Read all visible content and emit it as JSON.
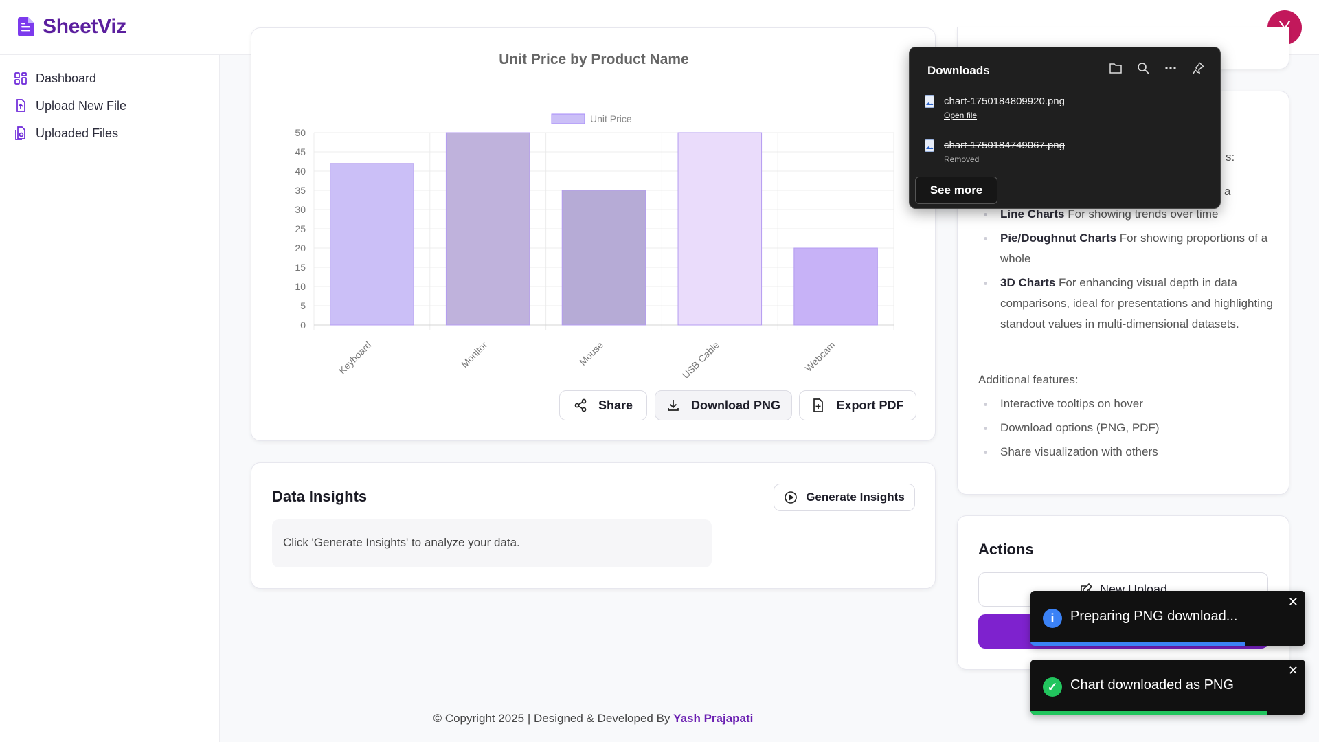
{
  "app": {
    "name": "SheetViz",
    "avatar_letter": "Y",
    "avatar_color": "#c2185b",
    "brand_color": "#5b1f9e"
  },
  "sidebar": {
    "items": [
      {
        "label": "Dashboard",
        "icon": "grid-icon"
      },
      {
        "label": "Upload New File",
        "icon": "file-upload-icon"
      },
      {
        "label": "Uploaded Files",
        "icon": "files-icon"
      }
    ]
  },
  "chart_data": {
    "type": "bar",
    "title": "Unit Price by Product Name",
    "categories": [
      "Keyboard",
      "Monitor",
      "Mouse",
      "USB Cable",
      "Webcam"
    ],
    "series": [
      {
        "name": "Unit Price",
        "values": [
          42,
          50,
          35,
          50,
          20
        ]
      }
    ],
    "bar_colors": [
      "#cbbff7",
      "#bfb2dc",
      "#b6abd6",
      "#eadcfb",
      "#c7b2f7"
    ],
    "ylim": [
      0,
      50
    ],
    "yticks": [
      0,
      5,
      10,
      15,
      20,
      25,
      30,
      35,
      40,
      45,
      50
    ],
    "grid": true,
    "legend": "top"
  },
  "chart_actions": {
    "share": "Share",
    "download": "Download PNG",
    "export": "Export PDF"
  },
  "insights": {
    "title": "Data Insights",
    "generate_label": "Generate Insights",
    "placeholder": "Click 'Generate Insights' to analyze your data."
  },
  "info": {
    "partial_line1": "s:",
    "partial_line2": "a",
    "chart_types": [
      {
        "name": "Line Charts",
        "desc": " For showing trends over time"
      },
      {
        "name": "Pie/Doughnut Charts",
        "desc": " For showing proportions of a whole"
      },
      {
        "name": "3D Charts",
        "desc": " For enhancing visual depth in data comparisons, ideal for presentations and highlighting standout values in multi-dimensional datasets."
      }
    ],
    "additional_label": "Additional features:",
    "features": [
      "Interactive tooltips on hover",
      "Download options (PNG, PDF)",
      "Share visualization with others"
    ]
  },
  "actions": {
    "title": "Actions",
    "new_upload": "New Upload",
    "primary_color": "#7e22ce"
  },
  "footer": {
    "text": "© Copyright 2025 | Designed & Developed By ",
    "author": "Yash Prajapati"
  },
  "downloads": {
    "title": "Downloads",
    "items": [
      {
        "name": "chart-1750184809920.png",
        "sub": "Open file"
      },
      {
        "name": "chart-1750184749067.png",
        "sub": "Removed"
      }
    ],
    "see_more": "See more"
  },
  "toasts": [
    {
      "message": "Preparing PNG download...",
      "type": "info",
      "color": "#3b82f6",
      "progress": 0.78
    },
    {
      "message": "Chart downloaded as PNG",
      "type": "success",
      "color": "#22c55e",
      "progress": 0.86
    }
  ]
}
